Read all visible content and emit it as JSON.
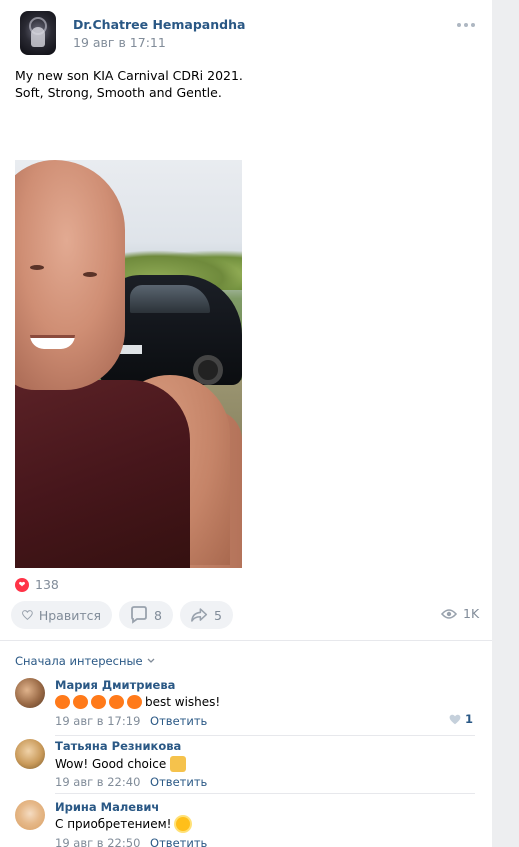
{
  "post": {
    "author": "Dr.Chatree Hemapandha",
    "time": "19 авг в 17:11",
    "text": "My new son KIA Carnival CDRi 2021.\nSoft, Strong, Smooth and Gentle.",
    "likes": "138",
    "actions": {
      "like_label": "Нравится",
      "comments": "8",
      "shares": "5"
    },
    "views": "1K"
  },
  "comments_section": {
    "sort_label": "Сначала интересные",
    "items": [
      {
        "name": "Мария Дмитриева",
        "text": "best wishes!",
        "emoji": [
          "orange-heart",
          "orange-heart",
          "orange-heart",
          "orange-heart",
          "orange-heart"
        ],
        "time": "19 авг в 17:19",
        "reply_label": "Ответить",
        "likes": "1"
      },
      {
        "name": "Татьяна Резникова",
        "text": "Wow! Good choice",
        "emoji": [
          "thumbs-up"
        ],
        "time": "19 авг в 22:40",
        "reply_label": "Ответить"
      },
      {
        "name": "Ирина Малевич",
        "text": "С приобретением!",
        "emoji": [
          "sun"
        ],
        "time": "19 авг в 22:50",
        "reply_label": "Ответить"
      }
    ]
  },
  "colors": {
    "link": "#2a5885",
    "muted": "#818c99",
    "like_red": "#ff3347",
    "background": "#edeef0"
  }
}
